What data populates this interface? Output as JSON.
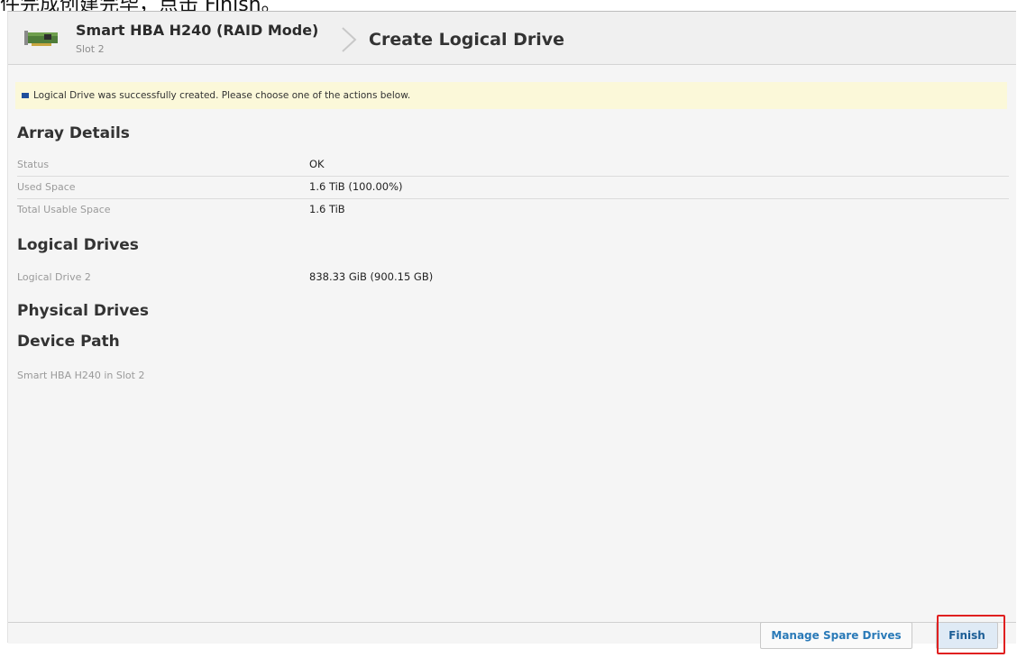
{
  "caption": {
    "text": "件完成创建完毕，点击 Finish。"
  },
  "header": {
    "controller_name": "Smart HBA H240 (RAID Mode)",
    "slot": "Slot 2",
    "page_title": "Create Logical Drive"
  },
  "message": {
    "text": "Logical Drive was successfully created. Please choose one of the actions below."
  },
  "array_details": {
    "title": "Array Details",
    "rows": [
      {
        "label": "Status",
        "value": "OK"
      },
      {
        "label": "Used Space",
        "value": "1.6 TiB (100.00%)"
      },
      {
        "label": "Total Usable Space",
        "value": "1.6 TiB"
      }
    ]
  },
  "logical_drives": {
    "title": "Logical Drives",
    "rows": [
      {
        "label": "Logical Drive 2",
        "value": "838.33 GiB (900.15 GB)"
      }
    ]
  },
  "physical_drives": {
    "title": "Physical Drives"
  },
  "device_path": {
    "title": "Device Path",
    "value": "Smart HBA H240 in Slot 2"
  },
  "footer": {
    "manage_spare_label": "Manage Spare Drives",
    "finish_label": "Finish"
  },
  "colors": {
    "message_bg": "#fbf8d9",
    "message_icon": "#1f4f9c",
    "button_text": "#2a7ab8",
    "highlight": "#e02020"
  },
  "icons": {
    "controller": "raid-card-icon",
    "breadcrumb": "chevron-right-icon",
    "message": "info-square-icon"
  }
}
